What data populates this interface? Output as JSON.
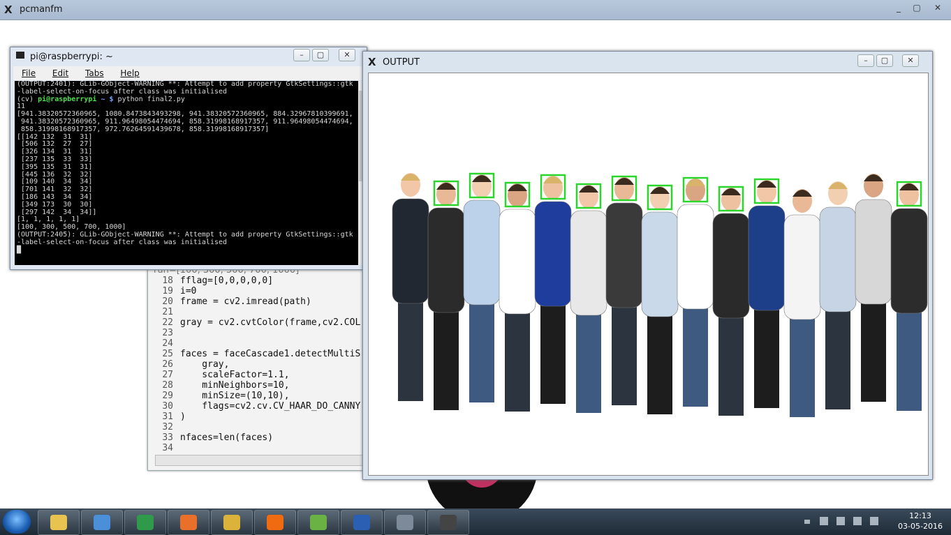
{
  "outer_window": {
    "title": "pcmanfm"
  },
  "terminal": {
    "title": "pi@raspberrypi: ~",
    "menu": [
      "File",
      "Edit",
      "Tabs",
      "Help"
    ],
    "lines": [
      "(OUTPUT:2401): GLib-GObject-WARNING **: Attempt to add property GtkSettings::gtk",
      "-label-select-on-focus after class was initialised",
      "11",
      "[941.38320572360965, 1080.8473843493298, 941.38320572360965, 884.32967810399691,",
      " 941.38320572360965, 911.96498054474694, 858.31998168917357, 911.96498054474694,",
      " 858.31998168917357, 972.76264591439678, 858.31998168917357]",
      "[[142 132  31  31]",
      " [506 132  27  27]",
      " [326 134  31  31]",
      " [237 135  33  33]",
      " [395 135  31  31]",
      " [445 136  32  32]",
      " [109 140  34  34]",
      " [701 141  32  32]",
      " [186 143  34  34]",
      " [349 173  30  30]",
      " [297 142  34  34]]",
      "[1, 1, 1, 1, 1]",
      "[100, 300, 500, 700, 1000]",
      "",
      "(OUTPUT:2405): GLib-GObject-WARNING **: Attempt to add property GtkSettings::gtk",
      "-label-select-on-focus after class was initialised"
    ],
    "prompt": {
      "env": "(cv)",
      "user": "pi@raspberrypi",
      "path": "~ $",
      "command": "python final2.py"
    }
  },
  "editor": {
    "partial_line": "run=[100, 300, 500, 700, 1000]",
    "lines": [
      {
        "n": "18",
        "code": "fflag=[0,0,0,0,0]"
      },
      {
        "n": "19",
        "code": "i=0"
      },
      {
        "n": "20",
        "code": "frame = cv2.imread(path)"
      },
      {
        "n": "21",
        "code": ""
      },
      {
        "n": "22",
        "code": "gray = cv2.cvtColor(frame,cv2.COL"
      },
      {
        "n": "23",
        "code": ""
      },
      {
        "n": "24",
        "code": ""
      },
      {
        "n": "25",
        "code": "faces = faceCascade1.detectMultiS"
      },
      {
        "n": "26",
        "code": "    gray,"
      },
      {
        "n": "27",
        "code": "    scaleFactor=1.1,"
      },
      {
        "n": "28",
        "code": "    minNeighbors=10,"
      },
      {
        "n": "29",
        "code": "    minSize=(10,10),"
      },
      {
        "n": "30",
        "code": "    flags=cv2.cv.CV_HAAR_DO_CANNY"
      },
      {
        "n": "31",
        "code": ")"
      },
      {
        "n": "32",
        "code": ""
      },
      {
        "n": "33",
        "code": "nfaces=len(faces)"
      },
      {
        "n": "34",
        "code": ""
      }
    ]
  },
  "output_window": {
    "title": "OUTPUT",
    "box_color": "#2bd62b",
    "people_count": 15
  },
  "taskbar": {
    "clock_time": "12:13",
    "clock_date": "03-05-2016",
    "apps": [
      "file-explorer-icon",
      "media-player-icon",
      "globe-icon",
      "firefox-icon",
      "chrome-icon",
      "mi-icon",
      "bluestacks-icon",
      "word-icon",
      "network-icon",
      "xming-icon"
    ]
  },
  "colors": {
    "terminal_bg": "#000000",
    "prompt_green": "#4ce24c",
    "prompt_blue": "#6ea8ff",
    "taskbar": "#263340"
  }
}
